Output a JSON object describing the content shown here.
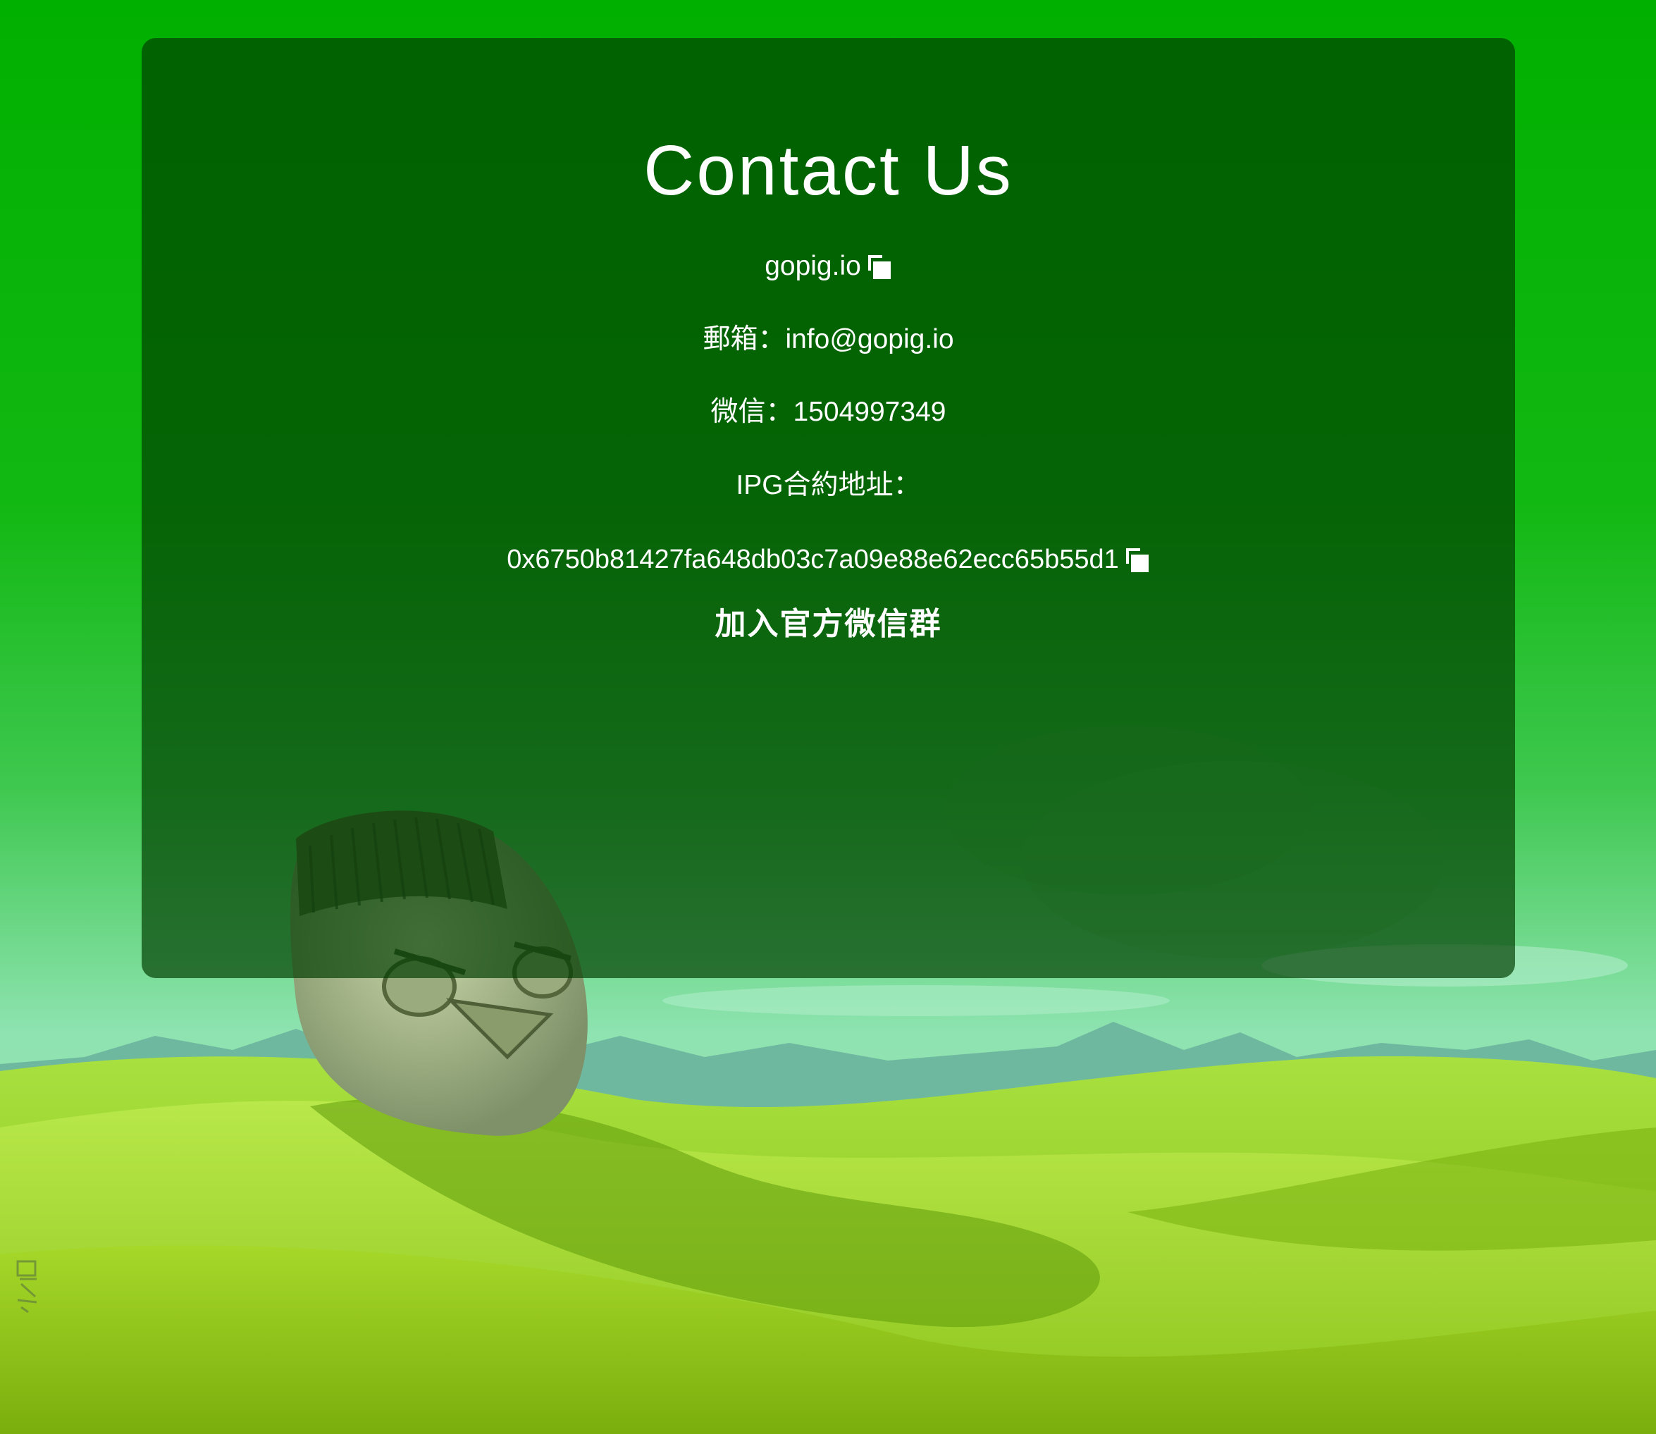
{
  "contact": {
    "title": "Contact Us",
    "site": "gopig.io",
    "email_label": "郵箱：",
    "email": "info@gopig.io",
    "wechat_label": "微信：",
    "wechat": "1504997349",
    "contract_label": "IPG合約地址：",
    "contract_address": "0x6750b81427fa648db03c7a09e88e62ecc65b55d1",
    "join_group": "加入官方微信群"
  },
  "icons": {
    "copy": "copy-icon"
  },
  "colors": {
    "background_top": "#00b000",
    "panel": "#0a4a0a",
    "text": "#ffffff",
    "grass": "#9bd61a",
    "sky_bottom": "#8ee3b0"
  }
}
